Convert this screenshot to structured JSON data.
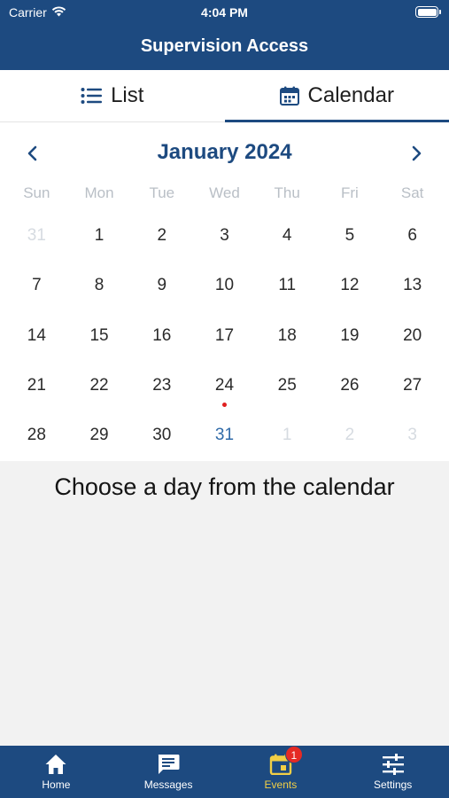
{
  "status_bar": {
    "carrier": "Carrier",
    "time": "4:04 PM"
  },
  "header": {
    "title": "Supervision Access"
  },
  "tabs": [
    {
      "label": "List",
      "icon": "list-icon",
      "active": false
    },
    {
      "label": "Calendar",
      "icon": "calendar-icon",
      "active": true
    }
  ],
  "calendar": {
    "month_label": "January 2024",
    "weekdays": [
      "Sun",
      "Mon",
      "Tue",
      "Wed",
      "Thu",
      "Fri",
      "Sat"
    ],
    "days": [
      {
        "label": "31",
        "muted": true
      },
      {
        "label": "1"
      },
      {
        "label": "2"
      },
      {
        "label": "3"
      },
      {
        "label": "4"
      },
      {
        "label": "5"
      },
      {
        "label": "6"
      },
      {
        "label": "7"
      },
      {
        "label": "8"
      },
      {
        "label": "9"
      },
      {
        "label": "10"
      },
      {
        "label": "11"
      },
      {
        "label": "12"
      },
      {
        "label": "13"
      },
      {
        "label": "14"
      },
      {
        "label": "15"
      },
      {
        "label": "16"
      },
      {
        "label": "17"
      },
      {
        "label": "18"
      },
      {
        "label": "19"
      },
      {
        "label": "20"
      },
      {
        "label": "21"
      },
      {
        "label": "22"
      },
      {
        "label": "23"
      },
      {
        "label": "24",
        "has_event": true
      },
      {
        "label": "25"
      },
      {
        "label": "26"
      },
      {
        "label": "27"
      },
      {
        "label": "28"
      },
      {
        "label": "29"
      },
      {
        "label": "30"
      },
      {
        "label": "31",
        "today": true
      },
      {
        "label": "1",
        "muted": true
      },
      {
        "label": "2",
        "muted": true
      },
      {
        "label": "3",
        "muted": true
      }
    ]
  },
  "empty_state": {
    "message": "Choose a day from the calendar"
  },
  "bottom_nav": [
    {
      "label": "Home",
      "icon": "home-icon",
      "active": false
    },
    {
      "label": "Messages",
      "icon": "message-icon",
      "active": false
    },
    {
      "label": "Events",
      "icon": "events-calendar-icon",
      "active": true,
      "badge": "1"
    },
    {
      "label": "Settings",
      "icon": "sliders-icon",
      "active": false
    }
  ],
  "colors": {
    "primary": "#1d4a80",
    "accent_active_tab": "#f2cf45",
    "badge": "#e52a24",
    "event_dot": "#e02020",
    "today_text": "#2f6aa8"
  }
}
